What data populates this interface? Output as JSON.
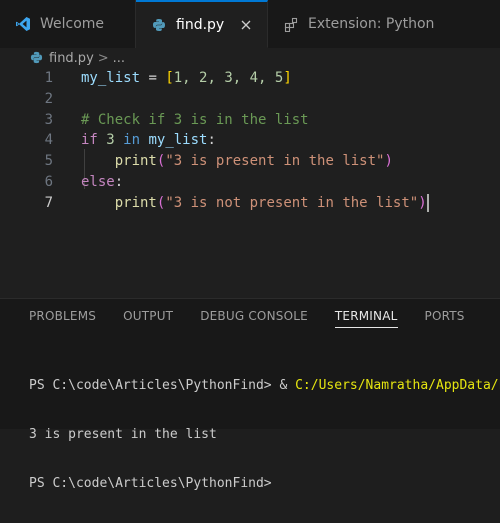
{
  "tabs": [
    {
      "label": "Welcome",
      "icon": "vscode-logo-icon",
      "active": false
    },
    {
      "label": "find.py",
      "icon": "python-file-icon",
      "active": true
    },
    {
      "label": "Extension: Python",
      "icon": "extensions-icon",
      "active": false
    }
  ],
  "breadcrumb": {
    "file": "find.py",
    "separator": ">",
    "more": "..."
  },
  "editor": {
    "current_line": 7,
    "lines": [
      {
        "n": "1",
        "tokens": [
          {
            "t": "my_list",
            "c": "#9cdcfe"
          },
          {
            "t": " = ",
            "c": "#d4d4d4"
          },
          {
            "t": "[",
            "c": "#ffd700"
          },
          {
            "t": "1, 2, 3, 4, 5",
            "c": "#b5cea8"
          },
          {
            "t": "]",
            "c": "#ffd700"
          }
        ]
      },
      {
        "n": "2",
        "tokens": []
      },
      {
        "n": "3",
        "tokens": [
          {
            "t": "# Check if 3 is in the list",
            "c": "#6a9955"
          }
        ]
      },
      {
        "n": "4",
        "tokens": [
          {
            "t": "if",
            "c": "#c586c0"
          },
          {
            "t": " ",
            "c": "#d4d4d4"
          },
          {
            "t": "3",
            "c": "#b5cea8"
          },
          {
            "t": " ",
            "c": "#d4d4d4"
          },
          {
            "t": "in",
            "c": "#569cd6"
          },
          {
            "t": " ",
            "c": "#d4d4d4"
          },
          {
            "t": "my_list",
            "c": "#9cdcfe"
          },
          {
            "t": ":",
            "c": "#d4d4d4"
          }
        ]
      },
      {
        "n": "5",
        "tokens": [
          {
            "t": "    ",
            "c": "#d4d4d4"
          },
          {
            "t": "print",
            "c": "#dcdcaa"
          },
          {
            "t": "(",
            "c": "#da70d6"
          },
          {
            "t": "\"3 is present in the list\"",
            "c": "#ce9178"
          },
          {
            "t": ")",
            "c": "#da70d6"
          }
        ]
      },
      {
        "n": "6",
        "tokens": [
          {
            "t": "else",
            "c": "#c586c0"
          },
          {
            "t": ":",
            "c": "#d4d4d4"
          }
        ]
      },
      {
        "n": "7",
        "tokens": [
          {
            "t": "    ",
            "c": "#d4d4d4"
          },
          {
            "t": "print",
            "c": "#dcdcaa"
          },
          {
            "t": "(",
            "c": "#da70d6"
          },
          {
            "t": "\"3 is not present in the list\"",
            "c": "#ce9178"
          },
          {
            "t": ")",
            "c": "#da70d6"
          }
        ]
      }
    ]
  },
  "panel": {
    "tabs": [
      "PROBLEMS",
      "OUTPUT",
      "DEBUG CONSOLE",
      "TERMINAL",
      "PORTS"
    ],
    "active_tab": "TERMINAL",
    "terminal": {
      "line1_prompt": "PS C:\\code\\Articles\\PythonFind> & ",
      "line1_path": "C:/Users/Namratha/AppData/Lo",
      "line2": "3 is present in the list",
      "line3": "PS C:\\code\\Articles\\PythonFind>"
    }
  },
  "colors": {
    "accent": "#0078d4",
    "background": "#1f1f1f",
    "terminal_path": "#e5e510"
  }
}
